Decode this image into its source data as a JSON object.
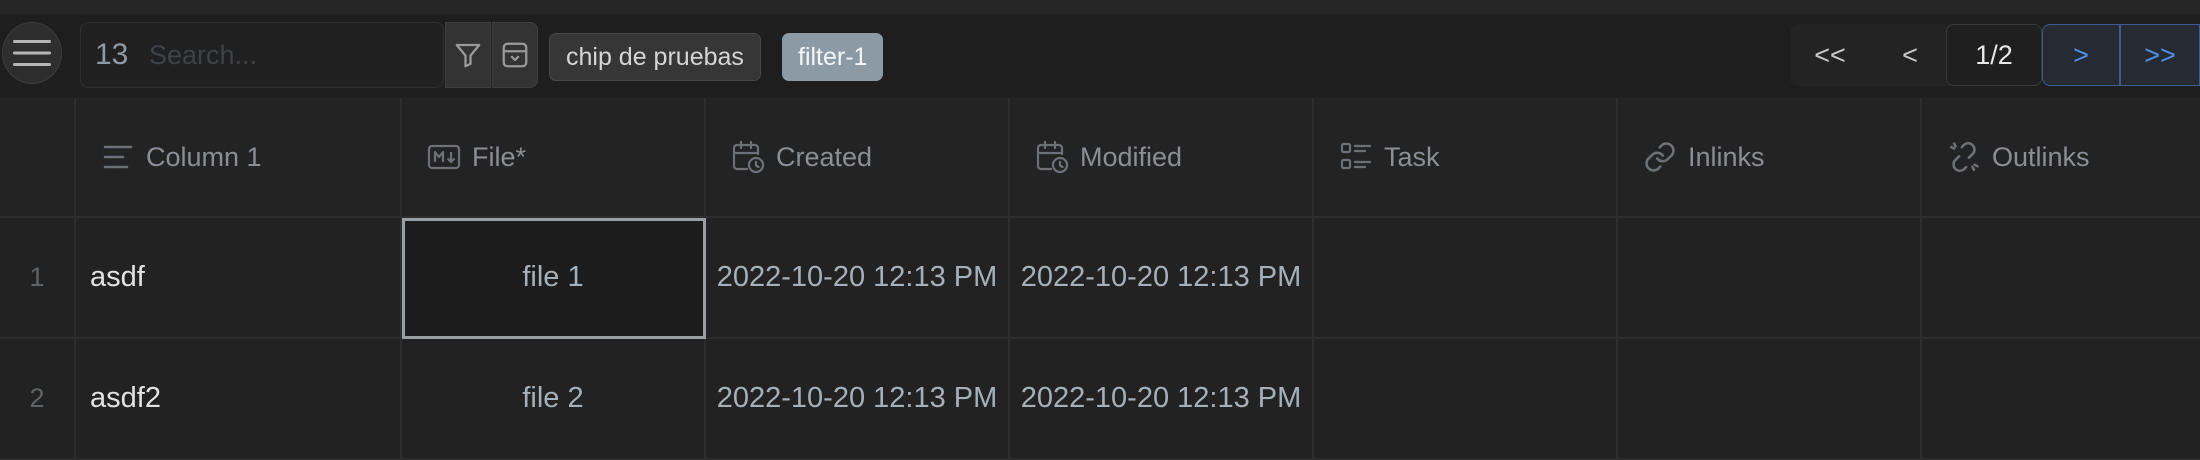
{
  "toolbar": {
    "menu_icon": "hamburger-icon",
    "search": {
      "count": "13",
      "placeholder": "Search..."
    },
    "filter_icon": "funnel-icon",
    "archive_icon": "archive-icon",
    "chips": [
      {
        "label": "chip de pruebas",
        "active": false
      },
      {
        "label": "filter-1",
        "active": true
      }
    ],
    "pagination": {
      "first": "<<",
      "prev": "<",
      "page": "1/2",
      "next": ">",
      "last": ">>"
    }
  },
  "table": {
    "columns": [
      {
        "label": "Column 1",
        "icon": "text-align-icon"
      },
      {
        "label": "File*",
        "icon": "markdown-icon"
      },
      {
        "label": "Created",
        "icon": "calendar-clock-icon"
      },
      {
        "label": "Modified",
        "icon": "calendar-clock-icon"
      },
      {
        "label": "Task",
        "icon": "task-list-icon"
      },
      {
        "label": "Inlinks",
        "icon": "link-icon"
      },
      {
        "label": "Outlinks",
        "icon": "broken-link-icon"
      }
    ],
    "rows": [
      {
        "num": "1",
        "col1": "asdf",
        "file": "file 1",
        "created": "2022-10-20 12:13 PM",
        "modified": "2022-10-20 12:13 PM",
        "task": "",
        "inlinks": "",
        "outlinks": ""
      },
      {
        "num": "2",
        "col1": "asdf2",
        "file": "file 2",
        "created": "2022-10-20 12:13 PM",
        "modified": "2022-10-20 12:13 PM",
        "task": "",
        "inlinks": "",
        "outlinks": ""
      }
    ]
  },
  "colors": {
    "accent": "#4f8ee8",
    "chip_active": "#8c9aa6",
    "background": "#1e1e1e"
  }
}
